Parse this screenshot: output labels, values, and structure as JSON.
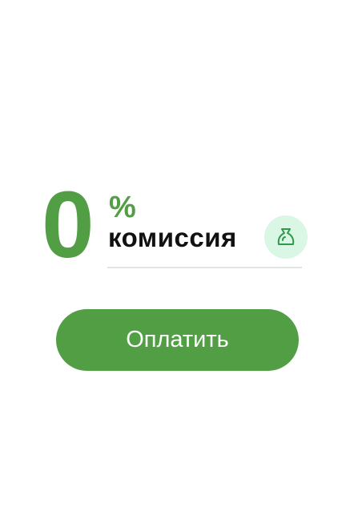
{
  "commission": {
    "value": "0",
    "percent_sign": "%",
    "label": "комиссия"
  },
  "icons": {
    "bag": "money-bag-icon"
  },
  "colors": {
    "accent": "#519e45",
    "icon_bg": "#daf6e4"
  },
  "pay_button": {
    "label": "Оплатить"
  }
}
